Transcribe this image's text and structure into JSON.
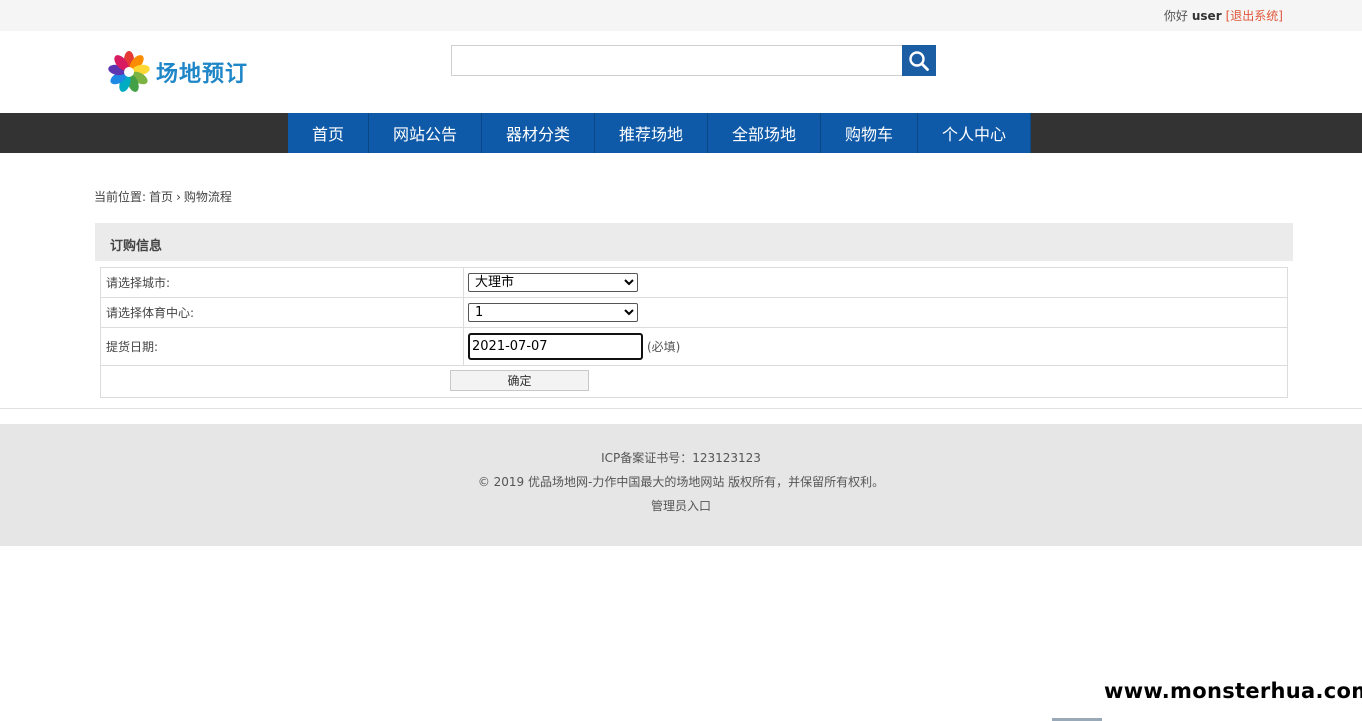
{
  "topbar": {
    "greeting": "你好",
    "username": "user",
    "logout_label": "[退出系统]"
  },
  "logo": {
    "text": "场地预订",
    "icon": "flower-logo-icon"
  },
  "search": {
    "value": "",
    "button_icon": "search-icon",
    "accent_color": "#1c5ea4"
  },
  "nav": {
    "items": [
      {
        "label": "首页"
      },
      {
        "label": "网站公告"
      },
      {
        "label": "器材分类"
      },
      {
        "label": "推荐场地"
      },
      {
        "label": "全部场地"
      },
      {
        "label": "购物车"
      },
      {
        "label": "个人中心"
      }
    ],
    "bar_color": "#333333",
    "item_color": "#0f5aa8"
  },
  "breadcrumb": {
    "prefix": "当前位置:",
    "home": "首页",
    "separator_icon": "chevron-right-icon",
    "current": "购物流程"
  },
  "order": {
    "title": "订购信息",
    "city_label": "请选择城市:",
    "city_value": "大理市",
    "center_label": "请选择体育中心:",
    "center_value": "1",
    "date_label": "提货日期:",
    "date_value": "2021-07-07",
    "required_note": "(必填)",
    "confirm_label": "确定"
  },
  "footer": {
    "icp": "ICP备案证书号：123123123",
    "copyright": "© 2019 优品场地网-力作中国最大的场地网站 版权所有，并保留所有权利。",
    "admin_link": "管理员入口"
  },
  "watermark": "www.monsterhua.com"
}
